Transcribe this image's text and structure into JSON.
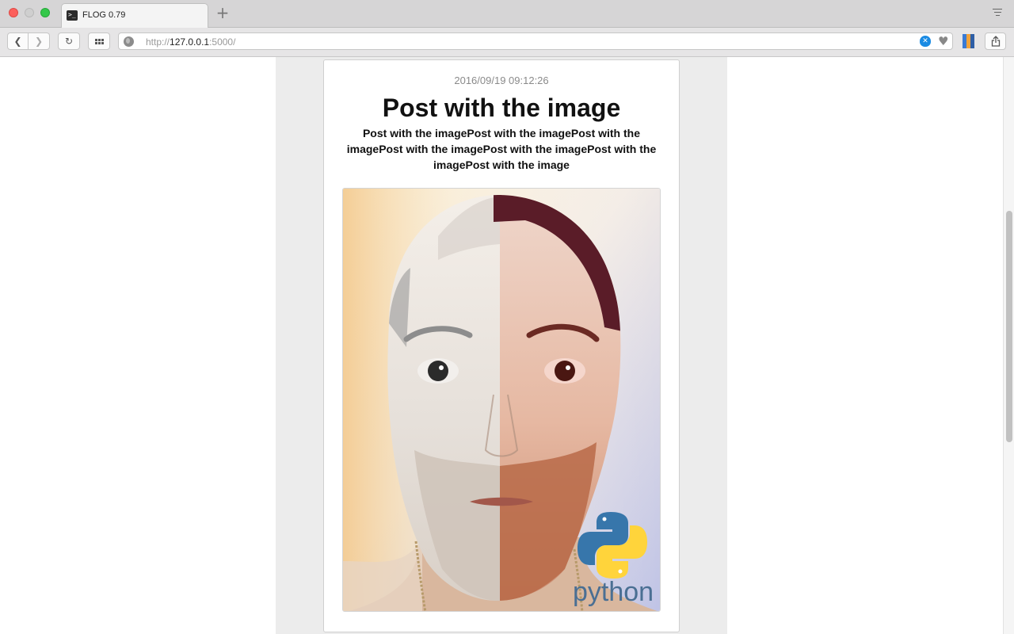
{
  "browser": {
    "tab": {
      "title": "FLOG 0.79",
      "favicon": "terminal-icon"
    },
    "new_tab": "+",
    "address": {
      "prefix": "http://",
      "host": "127.0.0.1",
      "port": ":5000/"
    },
    "icons": [
      "back-arrow-icon",
      "forward-arrow-icon",
      "reload-icon",
      "grid-icon",
      "globe-icon",
      "shield-icon",
      "heart-icon",
      "bookmarks-icon",
      "share-icon",
      "tab-list-icon"
    ]
  },
  "post": {
    "date": "2016/09/19 09:12:26",
    "title": "Post with the image",
    "body": "Post with the imagePost with the imagePost with the imagePost with the imagePost with the imagePost with the imagePost with the image",
    "image_caption_logo": "python"
  },
  "colors": {
    "column_background": "#ececec",
    "accent_blue": "#1a8be3",
    "python_blue": "#3776ab",
    "python_yellow": "#ffd43b"
  },
  "scrollbar": {
    "thumb_fraction_start": 0.27,
    "thumb_fraction_size": 0.4
  }
}
